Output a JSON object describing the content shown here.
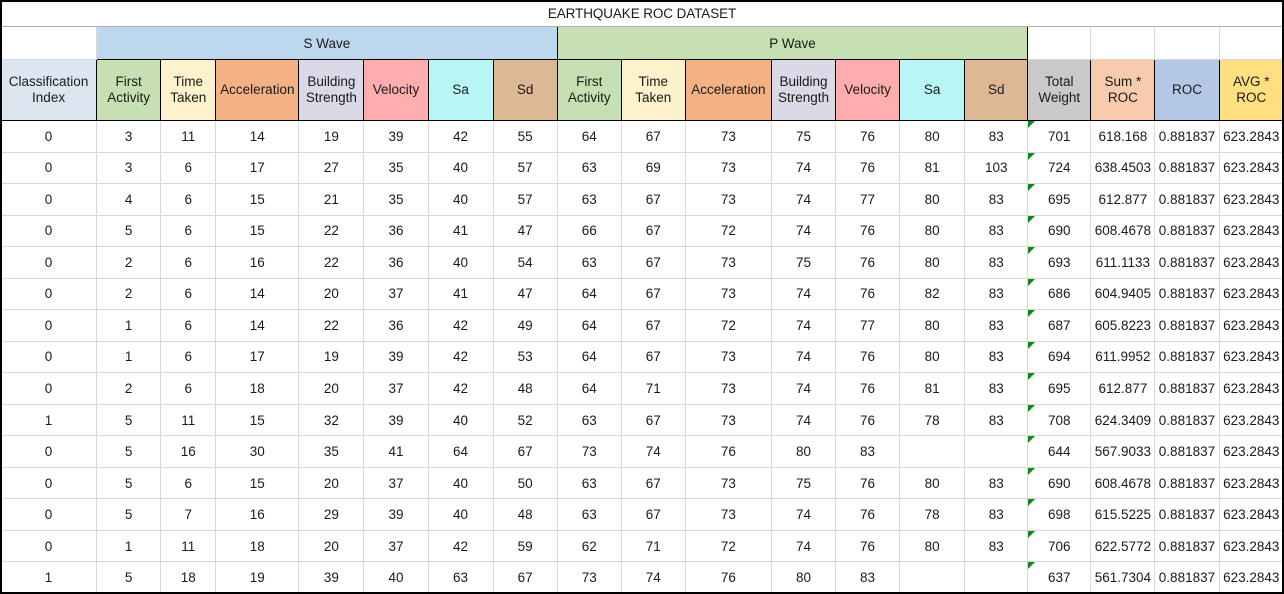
{
  "title": "EARTHQUAKE ROC DATASET",
  "groups": [
    {
      "label": "S Wave",
      "span": 7,
      "color": "#bdd7ee"
    },
    {
      "label": "P Wave",
      "span": 7,
      "color": "#c6e0b4"
    }
  ],
  "columns": [
    {
      "key": "classification_index",
      "label": "Classification Index",
      "color": "#dce6f1"
    },
    {
      "key": "s_first_activity",
      "label": "First Activity",
      "color": "#c6e0b4"
    },
    {
      "key": "s_time_taken",
      "label": "Time Taken",
      "color": "#fdf2cc"
    },
    {
      "key": "s_acceleration",
      "label": "Acceleration",
      "color": "#f4b183"
    },
    {
      "key": "s_building_strength",
      "label": "Building Strength",
      "color": "#d9d9e8"
    },
    {
      "key": "s_velocity",
      "label": "Velocity",
      "color": "#ffadad"
    },
    {
      "key": "s_sa",
      "label": "Sa",
      "color": "#b8f6f6"
    },
    {
      "key": "s_sd",
      "label": "Sd",
      "color": "#ddb894"
    },
    {
      "key": "p_first_activity",
      "label": "First Activity",
      "color": "#c6e0b4"
    },
    {
      "key": "p_time_taken",
      "label": "Time Taken",
      "color": "#fdf2cc"
    },
    {
      "key": "p_acceleration",
      "label": "Acceleration",
      "color": "#f4b183"
    },
    {
      "key": "p_building_strength",
      "label": "Building Strength",
      "color": "#d9d9e8"
    },
    {
      "key": "p_velocity",
      "label": "Velocity",
      "color": "#ffadad"
    },
    {
      "key": "p_sa",
      "label": "Sa",
      "color": "#b8f6f6"
    },
    {
      "key": "p_sd",
      "label": "Sd",
      "color": "#ddb894"
    },
    {
      "key": "total_weight",
      "label": "Total Weight",
      "color": "#c9c9c9"
    },
    {
      "key": "sum_roc",
      "label": "Sum * ROC",
      "color": "#f8cbad"
    },
    {
      "key": "roc",
      "label": "ROC",
      "color": "#b4c7e7"
    },
    {
      "key": "avg_roc",
      "label": "AVG * ROC",
      "color": "#ffdf80"
    }
  ],
  "header_lines": {
    "classification_index": [
      "Classification",
      "Index"
    ],
    "s_first_activity": [
      "First",
      "Activity"
    ],
    "s_time_taken": [
      "Time",
      "Taken"
    ],
    "s_acceleration": [
      "Acceleration"
    ],
    "s_building_strength": [
      "Building",
      "Strength"
    ],
    "s_velocity": [
      "Velocity"
    ],
    "s_sa": [
      "Sa"
    ],
    "s_sd": [
      "Sd"
    ],
    "p_first_activity": [
      "First",
      "Activity"
    ],
    "p_time_taken": [
      "Time",
      "Taken"
    ],
    "p_acceleration": [
      "Acceleration"
    ],
    "p_building_strength": [
      "Building",
      "Strength"
    ],
    "p_velocity": [
      "Velocity"
    ],
    "p_sa": [
      "Sa"
    ],
    "p_sd": [
      "Sd"
    ],
    "total_weight": [
      "Total",
      "Weight"
    ],
    "sum_roc": [
      "Sum *",
      "ROC"
    ],
    "roc": [
      "ROC"
    ],
    "avg_roc": [
      "AVG *",
      "ROC"
    ]
  },
  "error_indicator_column": "total_weight",
  "error_indicator_color": "#0f8a16",
  "rows": [
    [
      "0",
      "3",
      "11",
      "14",
      "19",
      "39",
      "42",
      "55",
      "64",
      "67",
      "73",
      "75",
      "76",
      "80",
      "83",
      "701",
      "618.168",
      "0.881837",
      "623.2843"
    ],
    [
      "0",
      "3",
      "6",
      "17",
      "27",
      "35",
      "40",
      "57",
      "63",
      "69",
      "73",
      "74",
      "76",
      "81",
      "103",
      "724",
      "638.4503",
      "0.881837",
      "623.2843"
    ],
    [
      "0",
      "4",
      "6",
      "15",
      "21",
      "35",
      "40",
      "57",
      "63",
      "67",
      "73",
      "74",
      "77",
      "80",
      "83",
      "695",
      "612.877",
      "0.881837",
      "623.2843"
    ],
    [
      "0",
      "5",
      "6",
      "15",
      "22",
      "36",
      "41",
      "47",
      "66",
      "67",
      "72",
      "74",
      "76",
      "80",
      "83",
      "690",
      "608.4678",
      "0.881837",
      "623.2843"
    ],
    [
      "0",
      "2",
      "6",
      "16",
      "22",
      "36",
      "40",
      "54",
      "63",
      "67",
      "73",
      "75",
      "76",
      "80",
      "83",
      "693",
      "611.1133",
      "0.881837",
      "623.2843"
    ],
    [
      "0",
      "2",
      "6",
      "14",
      "20",
      "37",
      "41",
      "47",
      "64",
      "67",
      "73",
      "74",
      "76",
      "82",
      "83",
      "686",
      "604.9405",
      "0.881837",
      "623.2843"
    ],
    [
      "0",
      "1",
      "6",
      "14",
      "22",
      "36",
      "42",
      "49",
      "64",
      "67",
      "72",
      "74",
      "77",
      "80",
      "83",
      "687",
      "605.8223",
      "0.881837",
      "623.2843"
    ],
    [
      "0",
      "1",
      "6",
      "17",
      "19",
      "39",
      "42",
      "53",
      "64",
      "67",
      "73",
      "74",
      "76",
      "80",
      "83",
      "694",
      "611.9952",
      "0.881837",
      "623.2843"
    ],
    [
      "0",
      "2",
      "6",
      "18",
      "20",
      "37",
      "42",
      "48",
      "64",
      "71",
      "73",
      "74",
      "76",
      "81",
      "83",
      "695",
      "612.877",
      "0.881837",
      "623.2843"
    ],
    [
      "1",
      "5",
      "11",
      "15",
      "32",
      "39",
      "40",
      "52",
      "63",
      "67",
      "73",
      "74",
      "76",
      "78",
      "83",
      "708",
      "624.3409",
      "0.881837",
      "623.2843"
    ],
    [
      "0",
      "5",
      "16",
      "30",
      "35",
      "41",
      "64",
      "67",
      "73",
      "74",
      "76",
      "80",
      "83",
      "",
      "",
      "644",
      "567.9033",
      "0.881837",
      "623.2843"
    ],
    [
      "0",
      "5",
      "6",
      "15",
      "20",
      "37",
      "40",
      "50",
      "63",
      "67",
      "73",
      "75",
      "76",
      "80",
      "83",
      "690",
      "608.4678",
      "0.881837",
      "623.2843"
    ],
    [
      "0",
      "5",
      "7",
      "16",
      "29",
      "39",
      "40",
      "48",
      "63",
      "67",
      "73",
      "74",
      "76",
      "78",
      "83",
      "698",
      "615.5225",
      "0.881837",
      "623.2843"
    ],
    [
      "0",
      "1",
      "11",
      "18",
      "20",
      "37",
      "42",
      "59",
      "62",
      "71",
      "72",
      "74",
      "76",
      "80",
      "83",
      "706",
      "622.5772",
      "0.881837",
      "623.2843"
    ],
    [
      "1",
      "5",
      "18",
      "19",
      "39",
      "40",
      "63",
      "67",
      "73",
      "74",
      "76",
      "80",
      "83",
      "",
      "",
      "637",
      "561.7304",
      "0.881837",
      "623.2843"
    ]
  ]
}
